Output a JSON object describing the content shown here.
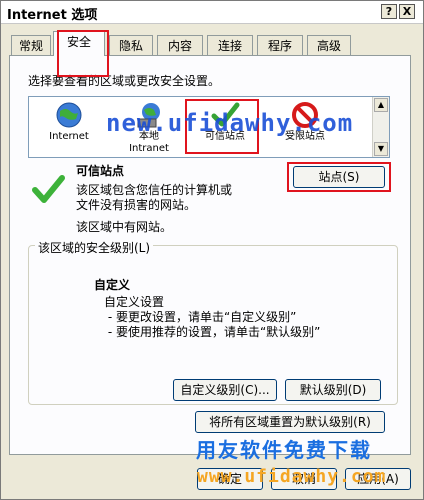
{
  "window": {
    "title": "Internet 选项",
    "help_label": "?",
    "close_label": "X"
  },
  "tabs": [
    {
      "label": "常规"
    },
    {
      "label": "安全"
    },
    {
      "label": "隐私"
    },
    {
      "label": "内容"
    },
    {
      "label": "连接"
    },
    {
      "label": "程序"
    },
    {
      "label": "高级"
    }
  ],
  "security": {
    "zone_prompt": "选择要查看的区域或更改安全设置。",
    "zones": [
      {
        "label": "Internet",
        "icon": "globe-icon"
      },
      {
        "label": "本地\nIntranet",
        "icon": "local-intranet-icon"
      },
      {
        "label": "可信站点",
        "icon": "trusted-sites-icon"
      },
      {
        "label": "受限站点",
        "icon": "restricted-sites-icon"
      }
    ],
    "selected_zone_title": "可信站点",
    "selected_zone_desc": "该区域包含您信任的计算机或\n文件没有损害的网站。",
    "zone_sites_note": "该区域中有网站。",
    "sites_button": "站点(S)",
    "level_group_label": "该区域的安全级别(L)",
    "level_title": "自定义",
    "level_desc": "自定义设置\n - 要更改设置，请单击“自定义级别”\n - 要使用推荐的设置，请单击“默认级别”",
    "custom_level_button": "自定义级别(C)...",
    "default_level_button": "默认级别(D)",
    "reset_all_button": "将所有区域重置为默认级别(R)"
  },
  "footer": {
    "ok_button": "确定",
    "cancel_button": "取消",
    "apply_button": "应用(A)"
  },
  "watermark": {
    "url": "new.ufidawhy.com",
    "banner": "用友软件免费下载",
    "url2": "www.ufidawhy.com"
  },
  "colors": {
    "highlight": "#e0141e",
    "watermark_blue": "#1a4fd6"
  }
}
